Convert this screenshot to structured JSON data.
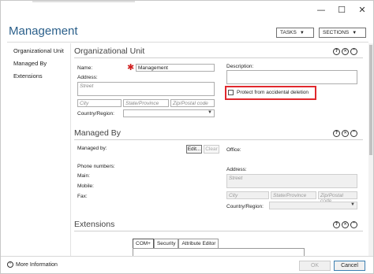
{
  "window": {
    "minimize_glyph": "—",
    "maximize_glyph": "☐",
    "close_glyph": "✕"
  },
  "header": {
    "title": "Management",
    "tasks_label": "TASKS",
    "sections_label": "SECTIONS",
    "chevron": "▼"
  },
  "nav": {
    "items": [
      {
        "label": "Organizational Unit"
      },
      {
        "label": "Managed By"
      },
      {
        "label": "Extensions"
      }
    ]
  },
  "controls": {
    "help": "?",
    "close": "✕",
    "collapse": "⌃"
  },
  "org_unit": {
    "title": "Organizational Unit",
    "name_label": "Name:",
    "name_value": "Management",
    "address_label": "Address:",
    "street_placeholder": "Street",
    "city_placeholder": "City",
    "state_placeholder": "State/Province",
    "zip_placeholder": "Zip/Postal code",
    "country_label": "Country/Region:",
    "description_label": "Description:",
    "protect_label": "Protect from accidental deletion",
    "protect_checked": false,
    "required_mark": "✱"
  },
  "managed_by": {
    "title": "Managed By",
    "managed_by_label": "Managed by:",
    "edit_label": "Edit...",
    "clear_label": "Clear",
    "office_label": "Office:",
    "phone_numbers_label": "Phone numbers:",
    "main_label": "Main:",
    "mobile_label": "Mobile:",
    "fax_label": "Fax:",
    "address_label": "Address:",
    "street_placeholder": "Street",
    "city_placeholder": "City",
    "state_placeholder": "State/Province",
    "zip_placeholder": "Zip/Postal code",
    "country_label": "Country/Region:"
  },
  "extensions": {
    "title": "Extensions",
    "tabs": [
      {
        "label": "COM+",
        "active": true
      },
      {
        "label": "Security",
        "active": false
      },
      {
        "label": "Attribute Editor",
        "active": false
      }
    ]
  },
  "footer": {
    "more_info_label": "More Information",
    "more_info_glyph": "⌃",
    "ok_label": "OK",
    "cancel_label": "Cancel"
  },
  "colors": {
    "title_blue": "#2a5f8a",
    "highlight_red": "#e0282d",
    "required_red": "#d02020"
  }
}
